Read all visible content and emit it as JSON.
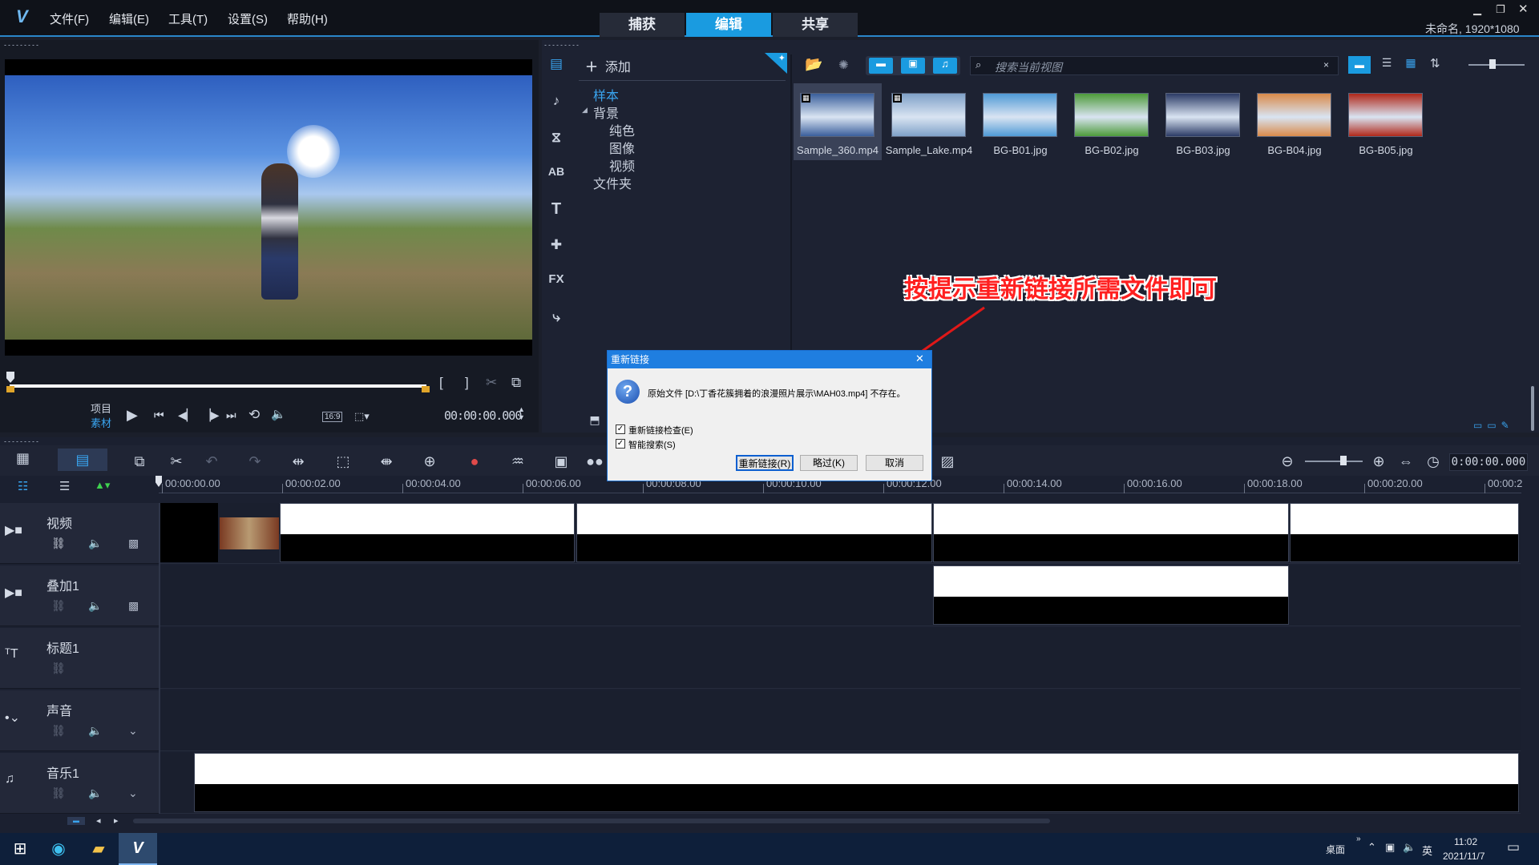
{
  "app": {
    "logo": "V",
    "menu": [
      "文件(F)",
      "编辑(E)",
      "工具(T)",
      "设置(S)",
      "帮助(H)"
    ],
    "modes": [
      "捕获",
      "编辑",
      "共享"
    ],
    "active_mode": "编辑",
    "project_info": "未命名, 1920*1080",
    "window_controls": [
      "minimize-icon",
      "restore-icon",
      "close-icon"
    ]
  },
  "player": {
    "mode_labels": [
      "项目",
      "素材"
    ],
    "aspect": "16:9",
    "timecode": "00:00:00.000",
    "trim_marks": [
      "[",
      "]"
    ]
  },
  "library": {
    "add_label": "添加",
    "tree": {
      "sample": "样本",
      "background": "背景",
      "children": [
        "纯色",
        "图像",
        "视频"
      ],
      "folder": "文件夹"
    },
    "search_placeholder": "搜索当前视图",
    "media": [
      {
        "name": "Sample_360.mp4",
        "color": "#3a5f9c"
      },
      {
        "name": "Sample_Lake.mp4",
        "color": "#7fa1c8"
      },
      {
        "name": "BG-B01.jpg",
        "color": "#4f9ad6"
      },
      {
        "name": "BG-B02.jpg",
        "color": "#4d9b3a"
      },
      {
        "name": "BG-B03.jpg",
        "color": "#2c3b66"
      },
      {
        "name": "BG-B04.jpg",
        "color": "#d98a4a"
      },
      {
        "name": "BG-B05.jpg",
        "color": "#b0281a"
      }
    ]
  },
  "annotation": "按提示重新链接所需文件即可",
  "dialog": {
    "title": "重新链接",
    "message": "原始文件 [D:\\丁香花簇拥着的浪漫照片展示\\MAH03.mp4] 不存在。",
    "check1": "重新链接检查(E)",
    "check2": "智能搜索(S)",
    "buttons": [
      "重新链接(R)",
      "略过(K)",
      "取消"
    ]
  },
  "timeline": {
    "timecode": "0:00:00.000",
    "ruler": [
      "00:00:00.00",
      "00:00:02.00",
      "00:00:04.00",
      "00:00:06.00",
      "00:00:08.00",
      "00:00:10.00",
      "00:00:12.00",
      "00:00:14.00",
      "00:00:16.00",
      "00:00:18.00",
      "00:00:20.00",
      "00:00:2"
    ],
    "tracks": [
      {
        "name": "视频",
        "icon": "video-track-icon"
      },
      {
        "name": "叠加1",
        "icon": "overlay-track-icon"
      },
      {
        "name": "标题1",
        "icon": "title-track-icon"
      },
      {
        "name": "声音",
        "icon": "voice-track-icon"
      },
      {
        "name": "音乐1",
        "icon": "music-track-icon"
      }
    ]
  },
  "taskbar": {
    "desktop": "桌面",
    "ime": "英",
    "time": "11:02",
    "date": "2021/11/7"
  }
}
